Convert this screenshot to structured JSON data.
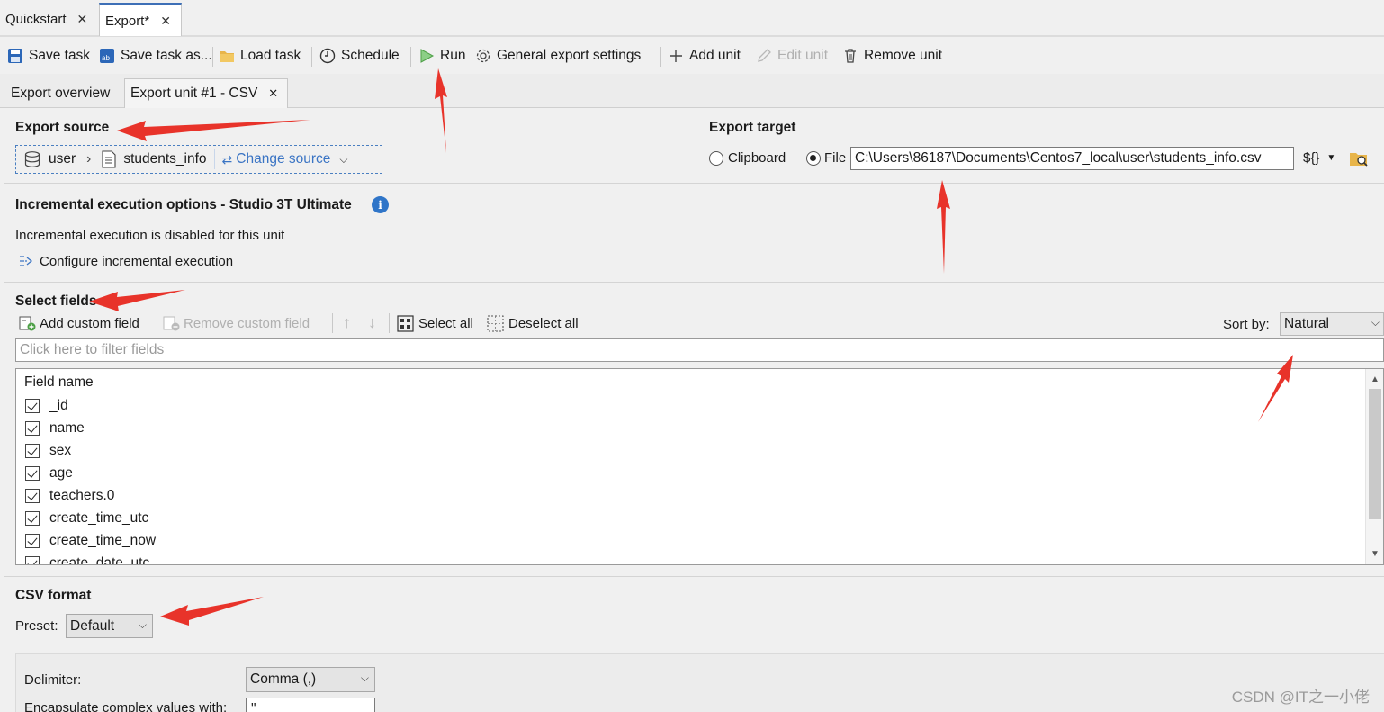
{
  "tabs": [
    {
      "label": "Quickstart"
    },
    {
      "label": "Export*"
    }
  ],
  "toolbar": {
    "save_task": "Save task",
    "save_task_as": "Save task as...",
    "load_task": "Load task",
    "schedule": "Schedule",
    "run": "Run",
    "general_settings": "General export settings",
    "add_unit": "Add unit",
    "edit_unit": "Edit unit",
    "remove_unit": "Remove unit"
  },
  "inner_tabs": [
    {
      "label": "Export overview"
    },
    {
      "label": "Export unit #1 - CSV"
    }
  ],
  "export_source": {
    "heading": "Export source",
    "database": "user",
    "collection": "students_info",
    "change_source": "Change source"
  },
  "export_target": {
    "heading": "Export target",
    "clipboard_label": "Clipboard",
    "file_label": "File",
    "selected": "File",
    "file_path": "C:\\Users\\86187\\Documents\\Centos7_local\\user\\students_info.csv",
    "var_button": "${}"
  },
  "incremental": {
    "heading": "Incremental execution options - Studio 3T Ultimate",
    "status": "Incremental execution is disabled for this unit",
    "configure_link": "Configure incremental execution"
  },
  "select_fields": {
    "heading": "Select fields",
    "add_custom": "Add custom field",
    "remove_custom": "Remove custom field",
    "select_all": "Select all",
    "deselect_all": "Deselect all",
    "sort_label": "Sort by:",
    "sort_value": "Natural",
    "filter_placeholder": "Click here to filter fields",
    "column_header": "Field name",
    "fields": [
      {
        "name": "_id",
        "checked": true
      },
      {
        "name": "name",
        "checked": true
      },
      {
        "name": "sex",
        "checked": true
      },
      {
        "name": "age",
        "checked": true
      },
      {
        "name": "teachers.0",
        "checked": true
      },
      {
        "name": "create_time_utc",
        "checked": true
      },
      {
        "name": "create_time_now",
        "checked": true
      },
      {
        "name": "create_date_utc",
        "checked": true
      }
    ]
  },
  "csv_format": {
    "heading": "CSV format",
    "preset_label": "Preset:",
    "preset_value": "Default",
    "delimiter_label": "Delimiter:",
    "delimiter_value": "Comma (,)",
    "encapsulate_label": "Encapsulate complex values with:",
    "encapsulate_value": "\""
  },
  "watermark": "CSDN @IT之一小佬",
  "colors": {
    "accent": "#3d6fb6",
    "link": "#3a74c4",
    "annotation_arrow": "#e8332a"
  }
}
